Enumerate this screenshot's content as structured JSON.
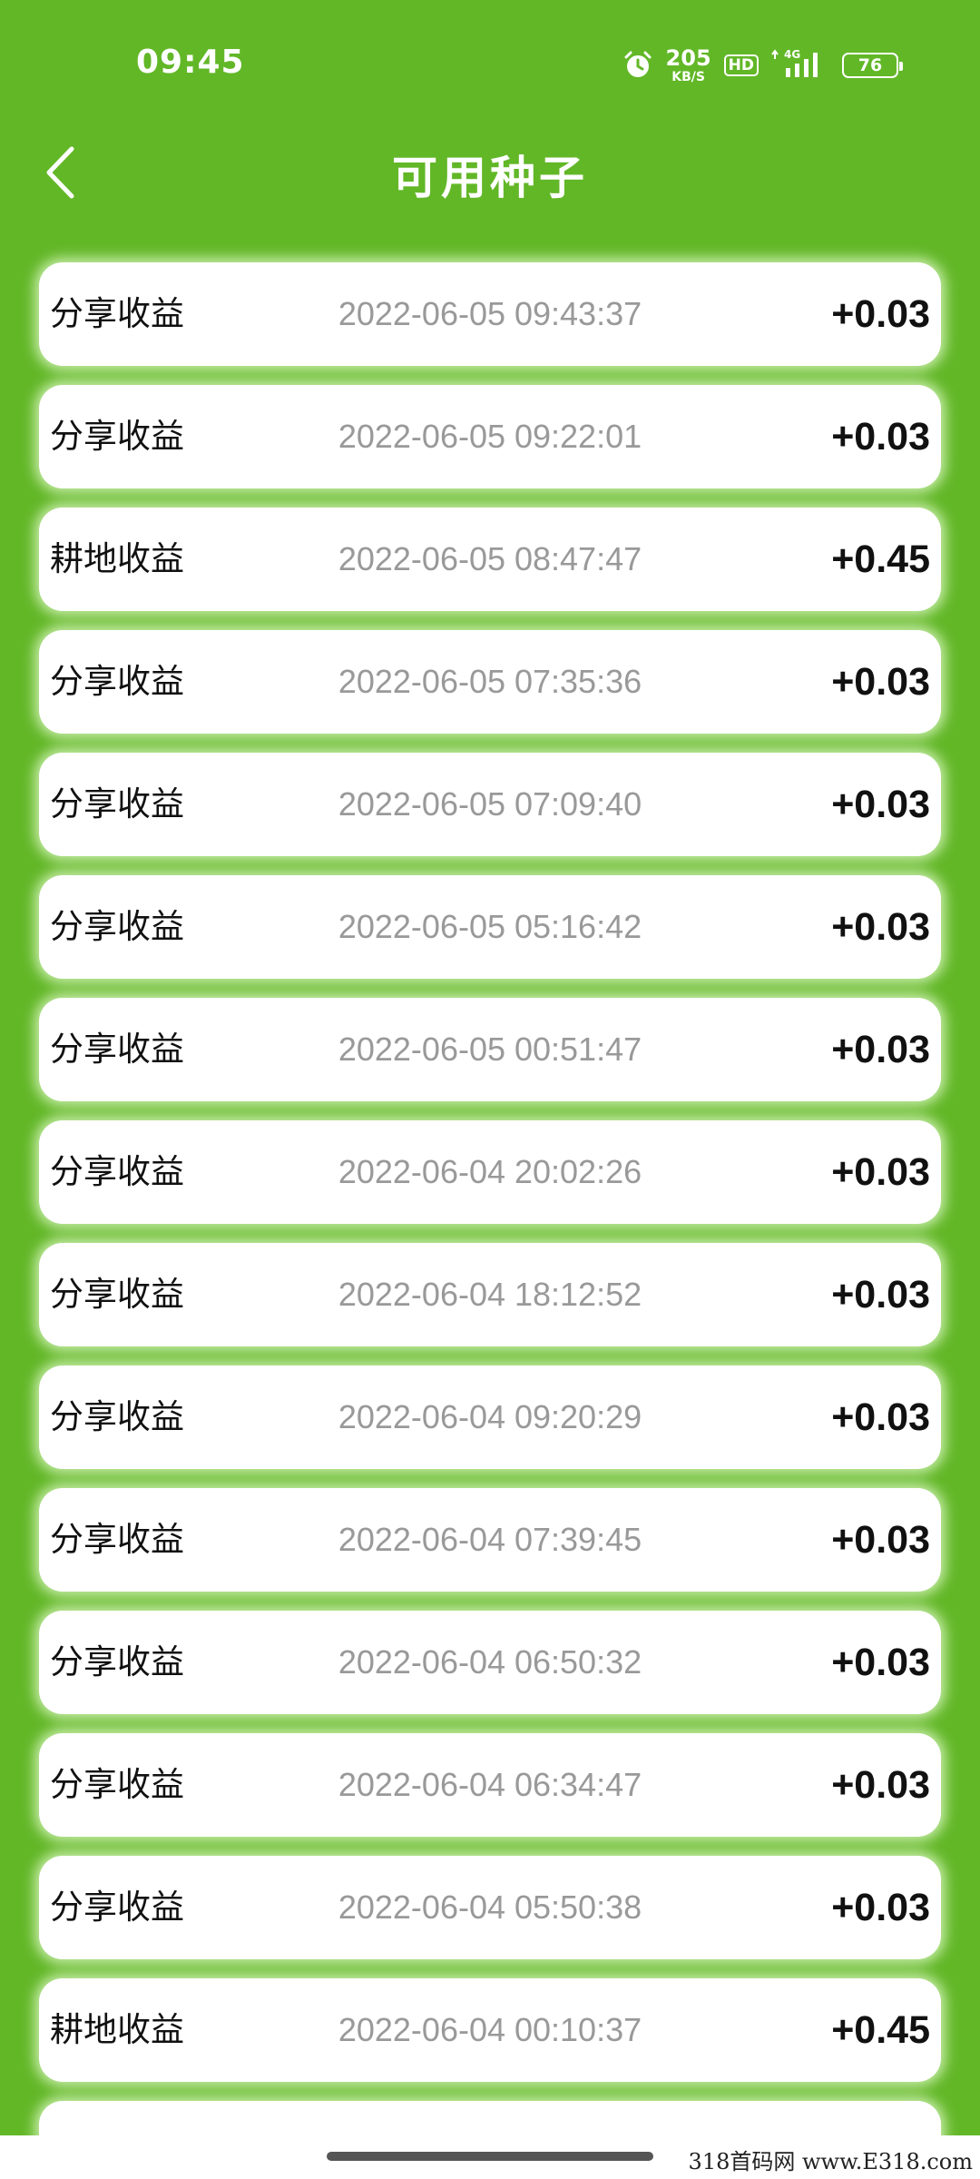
{
  "status_bar": {
    "time": "09:45",
    "net_speed_value": "205",
    "net_speed_unit": "KB/S",
    "hd_label": "HD",
    "network_type": "4G",
    "battery_level": "76",
    "icons": [
      "alarm-icon",
      "hd-icon",
      "signal-icon",
      "battery-icon"
    ]
  },
  "header": {
    "title": "可用种子",
    "back_icon": "chevron-left-icon"
  },
  "records": [
    {
      "type": "分享收益",
      "time": "2022-06-05 09:43:37",
      "amount": "+0.03"
    },
    {
      "type": "分享收益",
      "time": "2022-06-05 09:22:01",
      "amount": "+0.03"
    },
    {
      "type": "耕地收益",
      "time": "2022-06-05 08:47:47",
      "amount": "+0.45"
    },
    {
      "type": "分享收益",
      "time": "2022-06-05 07:35:36",
      "amount": "+0.03"
    },
    {
      "type": "分享收益",
      "time": "2022-06-05 07:09:40",
      "amount": "+0.03"
    },
    {
      "type": "分享收益",
      "time": "2022-06-05 05:16:42",
      "amount": "+0.03"
    },
    {
      "type": "分享收益",
      "time": "2022-06-05 00:51:47",
      "amount": "+0.03"
    },
    {
      "type": "分享收益",
      "time": "2022-06-04 20:02:26",
      "amount": "+0.03"
    },
    {
      "type": "分享收益",
      "time": "2022-06-04 18:12:52",
      "amount": "+0.03"
    },
    {
      "type": "分享收益",
      "time": "2022-06-04 09:20:29",
      "amount": "+0.03"
    },
    {
      "type": "分享收益",
      "time": "2022-06-04 07:39:45",
      "amount": "+0.03"
    },
    {
      "type": "分享收益",
      "time": "2022-06-04 06:50:32",
      "amount": "+0.03"
    },
    {
      "type": "分享收益",
      "time": "2022-06-04 06:34:47",
      "amount": "+0.03"
    },
    {
      "type": "分享收益",
      "time": "2022-06-04 05:50:38",
      "amount": "+0.03"
    },
    {
      "type": "耕地收益",
      "time": "2022-06-04 00:10:37",
      "amount": "+0.45"
    }
  ],
  "colors": {
    "background": "#62b727",
    "card": "#ffffff",
    "time_text": "#999999",
    "amount_text": "#111111"
  },
  "watermark": "318首码网 www.E318.com"
}
